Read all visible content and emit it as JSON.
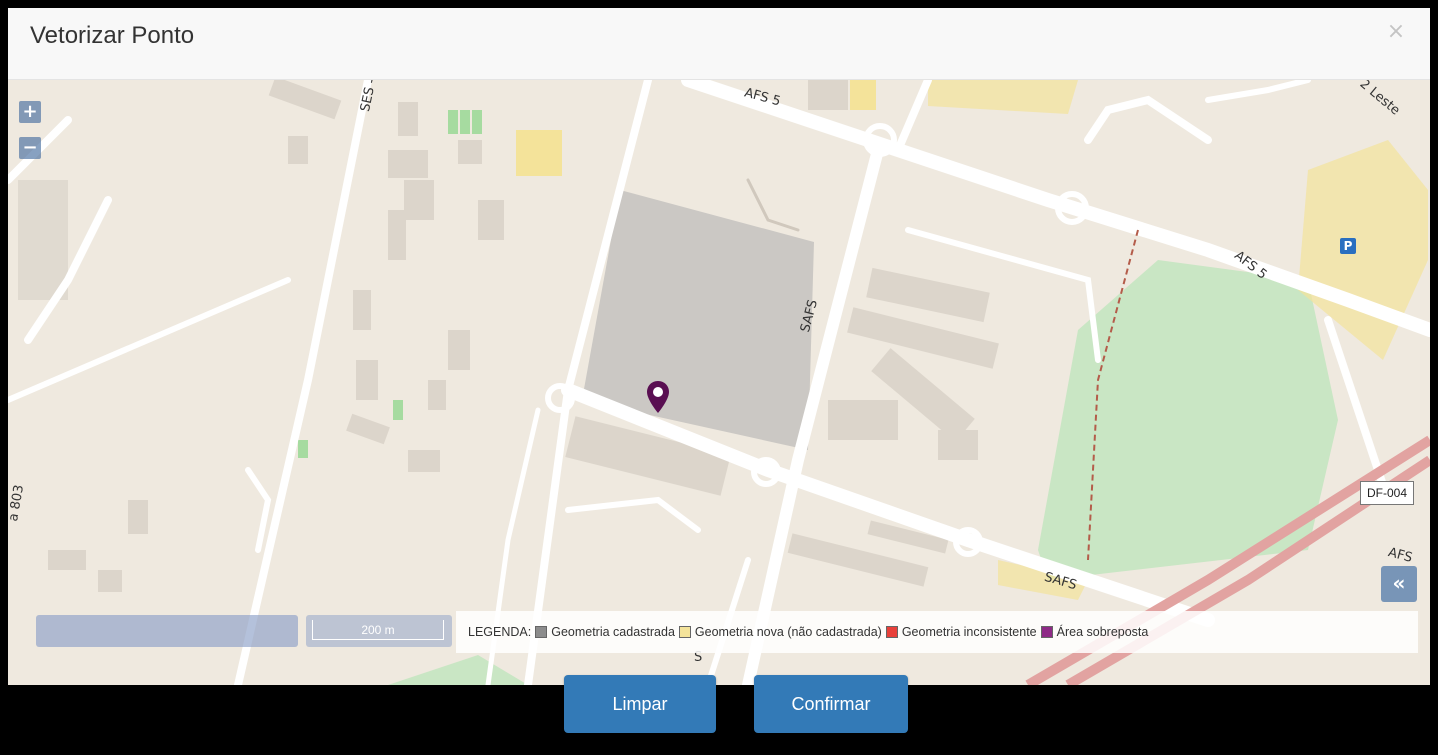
{
  "modal": {
    "title": "Vetorizar Ponto",
    "close_glyph": "×"
  },
  "map": {
    "zoom_in": "+",
    "zoom_out": "−",
    "layer_toggle": "«",
    "scale_label": "200 m",
    "marker_icon": "map-marker-icon",
    "road_labels": {
      "ses": "SES - Quadr",
      "afs5_top": "AFS 5",
      "afs5_right": "AFS 5",
      "safs_vertical": "SAFS",
      "safs_bottom": "SAFS",
      "leste": "2 Leste",
      "afs_edge": "AFS",
      "left_edge": "a 803",
      "s_bottom": "S",
      "df004": "DF-004",
      "parking": "P"
    },
    "colors": {
      "land": "#efe9df",
      "road": "#ffffff",
      "building": "#dcd5cb",
      "large_building": "#cbc8c4",
      "park": "#c9e6c4",
      "highway": "#e2a3a1",
      "marker": "#5a0f52"
    }
  },
  "legend": {
    "title": "LEGENDA:",
    "items": [
      {
        "label": "Geometria cadastrada",
        "color": "#8c8c8c"
      },
      {
        "label": "Geometria nova (não cadastrada)",
        "color": "#f4e39a"
      },
      {
        "label": "Geometria inconsistente",
        "color": "#e8403a"
      },
      {
        "label": "Área sobreposta",
        "color": "#8e2a86"
      }
    ]
  },
  "footer": {
    "clear_label": "Limpar",
    "confirm_label": "Confirmar"
  }
}
